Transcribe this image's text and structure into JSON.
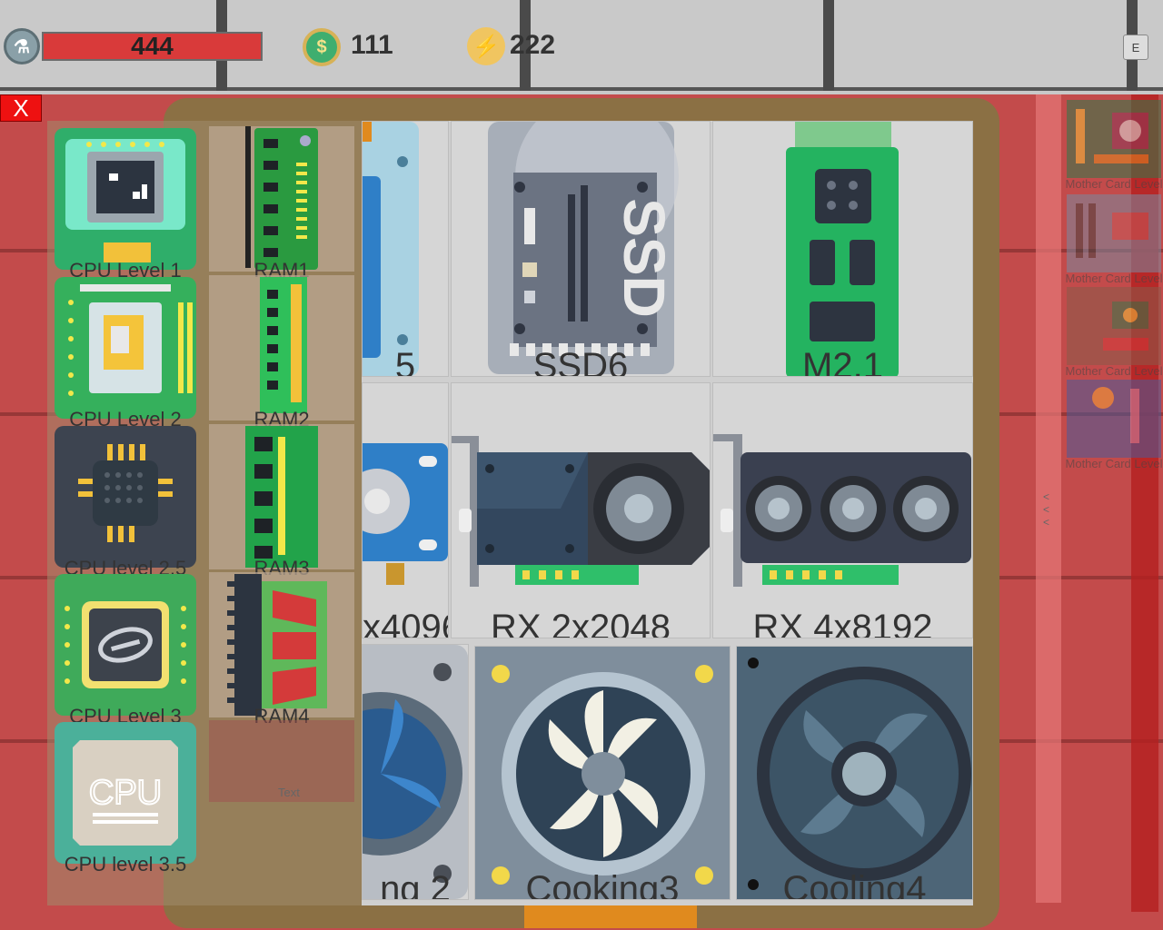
{
  "hud": {
    "health_value": "444",
    "coins_value": "111",
    "energy_value": "222",
    "e_button_label": "E"
  },
  "close_button_label": "X",
  "inventory": {
    "cpus": [
      {
        "label": "CPU Level 1"
      },
      {
        "label": "CPU Level 2"
      },
      {
        "label": "CPU level 2.5"
      },
      {
        "label": "CPU Level 3"
      },
      {
        "label": "CPU level 3.5"
      }
    ],
    "ram": [
      {
        "label": "RAM1"
      },
      {
        "label": "RAM2"
      },
      {
        "label": "RAM3"
      },
      {
        "label": "RAM4"
      }
    ],
    "placeholder_text": "Text",
    "cpu35_chip_text": "CPU"
  },
  "shop": {
    "items": [
      {
        "label": "5"
      },
      {
        "label": "SSD6",
        "chip_text": "SSD"
      },
      {
        "label": "M2.1"
      },
      {
        "label": "x4096"
      },
      {
        "label": "RX 2x2048"
      },
      {
        "label": "RX 4x8192"
      },
      {
        "label": "ng 2"
      },
      {
        "label": "Cooking3"
      },
      {
        "label": "Cooling4"
      }
    ]
  },
  "motherboards": [
    {
      "label": "Mother Card Level"
    },
    {
      "label": "Mother Card Level"
    },
    {
      "label": "Mother Card Level"
    },
    {
      "label": "Mother Card Level"
    }
  ],
  "scroll_arrows": "< < <"
}
